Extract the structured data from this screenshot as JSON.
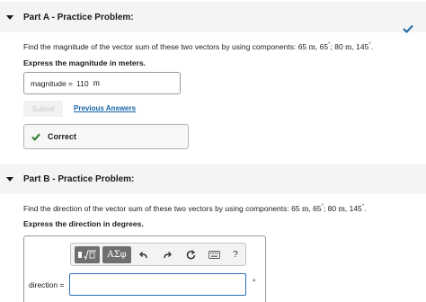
{
  "part_a": {
    "title": "Part A - Practice Problem:",
    "question_prefix": "Find the magnitude of the vector sum of these two vectors by using components: 65 ",
    "v1_unit": "m",
    "v1_angle": ", 65",
    "sep": "; 80 ",
    "v2_unit": "m",
    "v2_angle": ", 145",
    "deg": "°",
    "end": ".",
    "instruction": "Express the magnitude in meters.",
    "answer_label": "magnitude =",
    "answer_value": "110",
    "answer_unit": "m",
    "submit_label": "Submit",
    "previous_answers_label": "Previous Answers",
    "feedback_label": "Correct"
  },
  "part_b": {
    "title": "Part B - Practice Problem:",
    "question_prefix": "Find the direction of the vector sum of these two vectors by using components: 65 ",
    "v1_unit": "m",
    "v1_angle": ", 65",
    "sep": "; 80 ",
    "v2_unit": "m",
    "v2_angle": ", 145",
    "deg": "°",
    "end": ".",
    "instruction": "Express the direction in degrees.",
    "toolbar": {
      "greek_label": "ΑΣφ",
      "help_label": "?"
    },
    "answer_label": "direction =",
    "answer_value": "",
    "answer_unit": "°"
  },
  "colors": {
    "accent": "#1565a8",
    "success": "#2e7d32",
    "input_border_active": "#2b70b8"
  }
}
